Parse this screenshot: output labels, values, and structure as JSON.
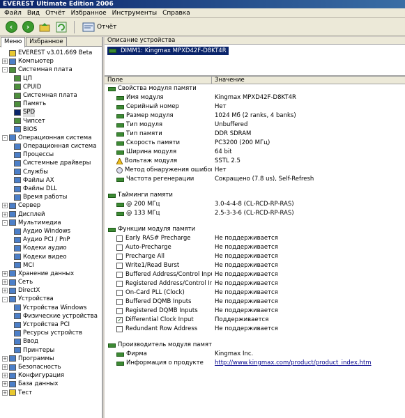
{
  "title": "EVEREST Ultimate Edition 2006",
  "menu": [
    "Файл",
    "Вид",
    "Отчёт",
    "Избранное",
    "Инструменты",
    "Справка"
  ],
  "toolbar": {
    "report": "Отчёт"
  },
  "tabs": [
    "Меню",
    "Избранное"
  ],
  "tree": [
    {
      "label": "EVEREST v3.01.669 Beta",
      "depth": 0,
      "exp": "",
      "icon": "yellow"
    },
    {
      "label": "Компьютер",
      "depth": 0,
      "exp": "+",
      "icon": "blue"
    },
    {
      "label": "Системная плата",
      "depth": 0,
      "exp": "-",
      "icon": "green"
    },
    {
      "label": "ЦП",
      "depth": 1,
      "exp": "",
      "icon": "green"
    },
    {
      "label": "CPUID",
      "depth": 1,
      "exp": "",
      "icon": "green"
    },
    {
      "label": "Системная плата",
      "depth": 1,
      "exp": "",
      "icon": "green"
    },
    {
      "label": "Память",
      "depth": 1,
      "exp": "",
      "icon": "green"
    },
    {
      "label": "SPD",
      "depth": 1,
      "exp": "",
      "icon": "sel",
      "selected": true
    },
    {
      "label": "Чипсет",
      "depth": 1,
      "exp": "",
      "icon": "green"
    },
    {
      "label": "BIOS",
      "depth": 1,
      "exp": "",
      "icon": "blue"
    },
    {
      "label": "Операционная система",
      "depth": 0,
      "exp": "-",
      "icon": "blue"
    },
    {
      "label": "Операционная система",
      "depth": 1,
      "exp": "",
      "icon": "blue"
    },
    {
      "label": "Процессы",
      "depth": 1,
      "exp": "",
      "icon": "blue"
    },
    {
      "label": "Системные драйверы",
      "depth": 1,
      "exp": "",
      "icon": "blue"
    },
    {
      "label": "Службы",
      "depth": 1,
      "exp": "",
      "icon": "blue"
    },
    {
      "label": "Файлы AX",
      "depth": 1,
      "exp": "",
      "icon": "blue"
    },
    {
      "label": "Файлы DLL",
      "depth": 1,
      "exp": "",
      "icon": "blue"
    },
    {
      "label": "Время работы",
      "depth": 1,
      "exp": "",
      "icon": "blue"
    },
    {
      "label": "Сервер",
      "depth": 0,
      "exp": "+",
      "icon": "blue"
    },
    {
      "label": "Дисплей",
      "depth": 0,
      "exp": "+",
      "icon": "blue"
    },
    {
      "label": "Мультимедиа",
      "depth": 0,
      "exp": "-",
      "icon": "blue"
    },
    {
      "label": "Аудио Windows",
      "depth": 1,
      "exp": "",
      "icon": "blue"
    },
    {
      "label": "Аудио PCI / PnP",
      "depth": 1,
      "exp": "",
      "icon": "blue"
    },
    {
      "label": "Кодеки аудио",
      "depth": 1,
      "exp": "",
      "icon": "blue"
    },
    {
      "label": "Кодеки видео",
      "depth": 1,
      "exp": "",
      "icon": "blue"
    },
    {
      "label": "MCI",
      "depth": 1,
      "exp": "",
      "icon": "blue"
    },
    {
      "label": "Хранение данных",
      "depth": 0,
      "exp": "+",
      "icon": "blue"
    },
    {
      "label": "Сеть",
      "depth": 0,
      "exp": "+",
      "icon": "blue"
    },
    {
      "label": "DirectX",
      "depth": 0,
      "exp": "+",
      "icon": "blue"
    },
    {
      "label": "Устройства",
      "depth": 0,
      "exp": "-",
      "icon": "blue"
    },
    {
      "label": "Устройства Windows",
      "depth": 1,
      "exp": "",
      "icon": "blue"
    },
    {
      "label": "Физические устройства",
      "depth": 1,
      "exp": "",
      "icon": "blue"
    },
    {
      "label": "Устройства PCI",
      "depth": 1,
      "exp": "",
      "icon": "blue"
    },
    {
      "label": "Ресурсы устройств",
      "depth": 1,
      "exp": "",
      "icon": "blue"
    },
    {
      "label": "Ввод",
      "depth": 1,
      "exp": "",
      "icon": "blue"
    },
    {
      "label": "Принтеры",
      "depth": 1,
      "exp": "",
      "icon": "blue"
    },
    {
      "label": "Программы",
      "depth": 0,
      "exp": "+",
      "icon": "blue"
    },
    {
      "label": "Безопасность",
      "depth": 0,
      "exp": "+",
      "icon": "blue"
    },
    {
      "label": "Конфигурация",
      "depth": 0,
      "exp": "+",
      "icon": "blue"
    },
    {
      "label": "База данных",
      "depth": 0,
      "exp": "+",
      "icon": "blue"
    },
    {
      "label": "Тест",
      "depth": 0,
      "exp": "+",
      "icon": "yellow"
    }
  ],
  "device_header": "Описание устройства",
  "device": "DIMM1: Kingmax MPXD42F-D8KT4R",
  "columns": {
    "field": "Поле",
    "value": "Значение"
  },
  "rows": [
    {
      "kind": "group",
      "icon": "mem",
      "field": "Свойства модуля памяти",
      "value": ""
    },
    {
      "kind": "item",
      "icon": "mem",
      "field": "Имя модуля",
      "value": "Kingmax MPXD42F-D8KT4R"
    },
    {
      "kind": "item",
      "icon": "mem",
      "field": "Серийный номер",
      "value": "Нет"
    },
    {
      "kind": "item",
      "icon": "mem",
      "field": "Размер модуля",
      "value": "1024 Мб (2 ranks, 4 banks)"
    },
    {
      "kind": "item",
      "icon": "mem",
      "field": "Тип модуля",
      "value": "Unbuffered"
    },
    {
      "kind": "item",
      "icon": "mem",
      "field": "Тип памяти",
      "value": "DDR SDRAM"
    },
    {
      "kind": "item",
      "icon": "mem",
      "field": "Скорость памяти",
      "value": "PC3200 (200 МГц)"
    },
    {
      "kind": "item",
      "icon": "mem",
      "field": "Ширина модуля",
      "value": "64 bit"
    },
    {
      "kind": "item",
      "icon": "warn",
      "field": "Вольтаж модуля",
      "value": "SSTL 2.5"
    },
    {
      "kind": "item",
      "icon": "magn",
      "field": "Метод обнаружения ошибок",
      "value": "Нет"
    },
    {
      "kind": "item",
      "icon": "mem",
      "field": "Частота регенерации",
      "value": "Сокращено (7.8 us), Self-Refresh"
    },
    {
      "kind": "gap"
    },
    {
      "kind": "group",
      "icon": "mem",
      "field": "Тайминги памяти",
      "value": ""
    },
    {
      "kind": "item",
      "icon": "mem",
      "field": "@ 200 МГц",
      "value": "3.0-4-4-8  (CL-RCD-RP-RAS)"
    },
    {
      "kind": "item",
      "icon": "mem",
      "field": "@ 133 МГц",
      "value": "2.5-3-3-6  (CL-RCD-RP-RAS)"
    },
    {
      "kind": "gap"
    },
    {
      "kind": "group",
      "icon": "mem",
      "field": "Функции модуля памяти",
      "value": ""
    },
    {
      "kind": "item",
      "icon": "cb",
      "checked": false,
      "field": "Early RAS# Precharge",
      "value": "Не поддерживается"
    },
    {
      "kind": "item",
      "icon": "cb",
      "checked": false,
      "field": "Auto-Precharge",
      "value": "Не поддерживается"
    },
    {
      "kind": "item",
      "icon": "cb",
      "checked": false,
      "field": "Precharge All",
      "value": "Не поддерживается"
    },
    {
      "kind": "item",
      "icon": "cb",
      "checked": false,
      "field": "Write1/Read Burst",
      "value": "Не поддерживается"
    },
    {
      "kind": "item",
      "icon": "cb",
      "checked": false,
      "field": "Buffered Address/Control Inputs",
      "value": "Не поддерживается"
    },
    {
      "kind": "item",
      "icon": "cb",
      "checked": false,
      "field": "Registered Address/Control In...",
      "value": "Не поддерживается"
    },
    {
      "kind": "item",
      "icon": "cb",
      "checked": false,
      "field": "On-Card PLL (Clock)",
      "value": "Не поддерживается"
    },
    {
      "kind": "item",
      "icon": "cb",
      "checked": false,
      "field": "Buffered DQMB Inputs",
      "value": "Не поддерживается"
    },
    {
      "kind": "item",
      "icon": "cb",
      "checked": false,
      "field": "Registered DQMB Inputs",
      "value": "Не поддерживается"
    },
    {
      "kind": "item",
      "icon": "cb",
      "checked": true,
      "field": "Differential Clock Input",
      "value": "Поддерживается"
    },
    {
      "kind": "item",
      "icon": "cb",
      "checked": false,
      "field": "Redundant Row Address",
      "value": "Не поддерживается"
    },
    {
      "kind": "gap"
    },
    {
      "kind": "group",
      "icon": "mem",
      "field": "Производитель модуля памяти",
      "value": ""
    },
    {
      "kind": "item",
      "icon": "mem",
      "field": "Фирма",
      "value": "Kingmax Inc."
    },
    {
      "kind": "item",
      "icon": "mem",
      "field": "Информация о продукте",
      "value": "http://www.kingmax.com/product/product_index.htm",
      "link": true
    }
  ]
}
